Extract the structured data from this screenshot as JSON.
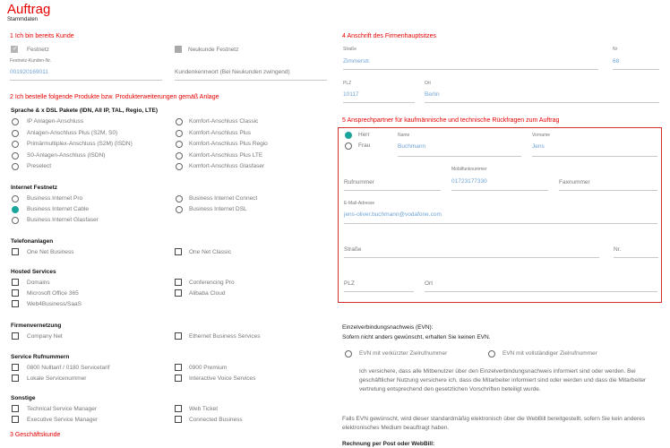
{
  "header": {
    "title": "Auftrag",
    "subtitle": "Stammdaten"
  },
  "s1": {
    "title": "1 Ich bin bereits Kunde",
    "festnetz": "Festnetz",
    "neukunde": "Neukunde Festnetz",
    "kdnr_label": "Festnetz-Kunden-Nr.",
    "kdnr_value": "001920169011",
    "kennwort": "Kundenkennwort (Bei Neukunden zwingend)"
  },
  "s2": {
    "title": "2 Ich bestelle folgende Produkte bzw. Produkterweiterungen gemäß Anlage",
    "sprache_title": "Sprache & x DSL Pakete (IDN, All IP, TAL, Regio, LTE)",
    "sprache_left": [
      "IP Anlagen-Anschluss",
      "Anlagen-Anschluss Plus (S2M, S0)",
      "Primärmultiplex-Anschluss (S2M) (ISDN)",
      "S0-Anlagen-Anschluss (ISDN)",
      "Preselect"
    ],
    "sprache_right": [
      "Komfort-Anschluss Classic",
      "Komfort-Anschluss Plus",
      "Komfort-Anschluss Plus Regio",
      "Komfort-Anschluss Plus LTE",
      "Komfort-Anschluss Glasfaser"
    ],
    "internet_title": "Internet Festnetz",
    "internet_left": [
      "Business Internet Pro",
      "Business Internet Cable",
      "Business Internet Glasfaser"
    ],
    "internet_right": [
      "Business Internet Connect",
      "Business Internet DSL"
    ],
    "tel_title": "Telefonanlagen",
    "tel_items": [
      "One Net Business",
      "One Net Classic"
    ],
    "hosted_title": "Hosted Services",
    "hosted_left": [
      "Domains",
      "Microsoft Office 365",
      "Web4Business/SaaS"
    ],
    "hosted_right": [
      "Conferencing Pro",
      "Alibaba Cloud"
    ],
    "firmen_title": "Firmenvernetzung",
    "firmen_items": [
      "Company Net",
      "Ethernet Business Services"
    ],
    "service_title": "Service Rufnummern",
    "service_left": [
      "0800 Nulltarif / 0180 Servicetarif",
      "Lokale Servicenummer"
    ],
    "service_right": [
      "0900 Premium",
      "Interactive Voice Services"
    ],
    "sonst_title": "Sonstige",
    "sonst_left": [
      "Technical Service Manager",
      "Executive Service Manager"
    ],
    "sonst_right": [
      "Web Ticket",
      "Connected Business"
    ]
  },
  "s3": {
    "title": "3 Geschäftskunde"
  },
  "s4": {
    "title": "4 Anschrift des Firmenhauptsitzes",
    "strasse_label": "Straße",
    "strasse_value": "Zimmerstr.",
    "nr_label": "Nr",
    "nr_value": "68",
    "plz_label": "PLZ",
    "plz_value": "10117",
    "ort_label": "Ort",
    "ort_value": "Berlin"
  },
  "s5": {
    "title": "5 Ansprechpartner für kaufmännische und technische Rückfragen zum Auftrag",
    "herr": "Herr",
    "frau": "Frau",
    "name_label": "Name",
    "name_value": "Buchmann",
    "vorname_label": "Vorname",
    "vorname_value": "Jens",
    "rufnummer": "Rufnummer",
    "mobil_label": "Mobilfunknummer",
    "mobil_value": "01723177330",
    "fax": "Faxnummer",
    "email_label": "E-Mail-Adresse",
    "email_value": "jens-oliver.buchmann@vodafone.com",
    "strasse": "Straße",
    "nr": "Nr.",
    "plz": "PLZ",
    "ort": "Ort"
  },
  "evn": {
    "title": "Einzelverbindungsnachweis (EVN):",
    "subtitle": "Sofern nicht anders gewünscht, erhalten Sie keinen EVN.",
    "opt1": "EVN mit verkürzter Zielrufnummer",
    "opt2": "EVN mit vollständiger Zielrufnummer",
    "para1": "Ich versichere, dass alle Mitbenutzer über den Einzelverbindungsnachweis informiert sind oder werden. Bei geschäftlicher Nutzung versichere ich, dass die Mitarbeiter informiert sind oder werden und dass die Mitarbeiter vertretung entsprechend den gesetzlichen Vorschriften beteiligt wurde.",
    "para2": "Falls EVN gewünscht, wird dieser standardmäßig elektronisch über die WebBill bereitgestellt, sofern Sie kein anderes elektronisches Medium beauftragt haben.",
    "rechnung": "Rechnung per Post oder WebBill:"
  },
  "colors": {
    "accent": "#e60000",
    "teal": "#1aa59a",
    "link": "#6fa3d6"
  }
}
